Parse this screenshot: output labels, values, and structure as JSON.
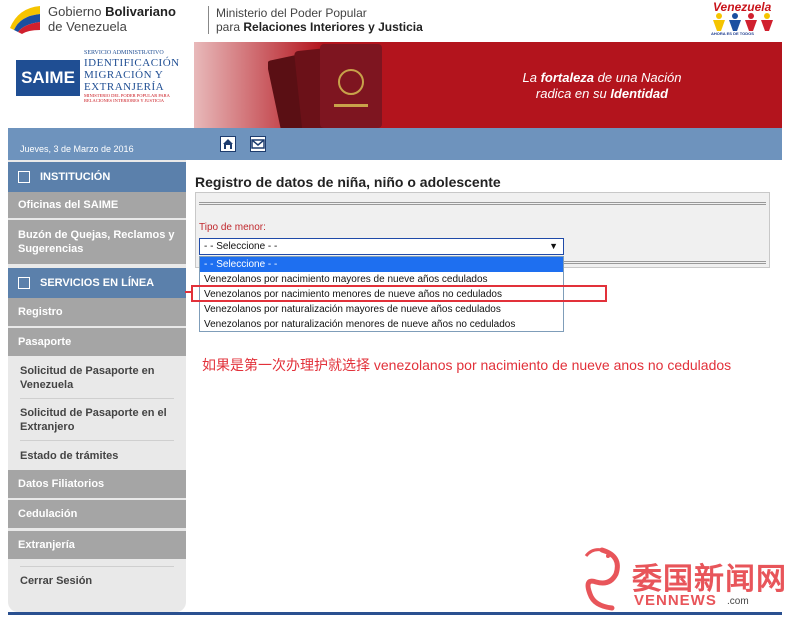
{
  "gov": {
    "line1_a": "Gobierno ",
    "line1_b": "Bolivariano",
    "line2": "de Venezuela",
    "ministry1": "Ministerio del Poder Popular",
    "ministry2_a": "para ",
    "ministry2_b": "Relaciones Interiores y Justicia",
    "logo_text": "Venezuela",
    "logo_sub": "AHORA ES DE TODOS"
  },
  "banner": {
    "saime": "SAIME",
    "service": "SERVICIO ADMINISTRATIVO",
    "line1": "IDENTIFICACIÓN",
    "line2": "MIGRACIÓN Y",
    "line3": "EXTRANJERÍA",
    "mini": "MINISTERIO DEL PODER POPULAR PARA RELACIONES INTERIORES Y JUSTICIA",
    "slogan_1a": "La ",
    "slogan_1b": "fortaleza",
    "slogan_1c": " de una Nación",
    "slogan_2a": "radica en su ",
    "slogan_2b": "Identidad"
  },
  "strip": {
    "date": "Jueves, 3 de Marzo de 2016"
  },
  "sidebar": {
    "institucion": "INSTITUCIÓN",
    "oficinas": "Oficinas del SAIME",
    "buzon": "Buzón de Quejas, Reclamos y Sugerencias",
    "servicios": "SERVICIOS EN LÍNEA",
    "registro": "Registro",
    "pasaporte": "Pasaporte",
    "sub1": "Solicitud de Pasaporte en Venezuela",
    "sub2": "Solicitud de Pasaporte en el Extranjero",
    "sub3": "Estado de trámites",
    "datos": "Datos Filiatorios",
    "cedulacion": "Cedulación",
    "extranjeria": "Extranjería",
    "cerrar": "Cerrar Sesión"
  },
  "main": {
    "title": "Registro de datos de niña, niño o adolescente",
    "field_label": "Tipo de menor:",
    "select_value": "- - Seleccione - -",
    "options": [
      "- - Seleccione - -",
      "Venezolanos por nacimiento mayores de nueve años cedulados",
      "Venezolanos por nacimiento menores de nueve años no cedulados",
      "Venezolanos por naturalización mayores de nueve años cedulados",
      "Venezolanos por naturalización menores de nueve años no cedulados"
    ],
    "note": "如果是第一次办理护就选择 venezolanos por nacimiento de nueve anos no cedulados"
  },
  "watermark": {
    "cn": "委国新闻网",
    "en": "VENNEWS",
    "site": ".com"
  }
}
